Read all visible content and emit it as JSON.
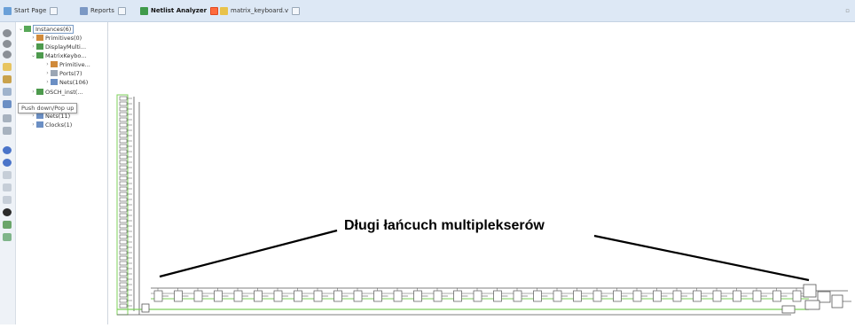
{
  "tabs": [
    {
      "label": "Start Page",
      "icon": "start-page-icon",
      "active": false
    },
    {
      "label": "Reports",
      "icon": "reports-icon",
      "active": false
    },
    {
      "label": "Netlist Analyzer",
      "icon": "netlist-analyzer-icon",
      "active": true
    },
    {
      "label": "matrix_keyboard.v",
      "icon": "verilog-file-icon",
      "active": false
    }
  ],
  "tooltip": "Push down/Pop up",
  "tree": {
    "instances": "Instances(6)",
    "primitives_1": "Primitives(0)",
    "display_multi": "DisplayMulti...",
    "matrix_keybo": "MatrixKeybo...",
    "primitive_2": "Primitive...",
    "ports": "Ports(7)",
    "nets_inner": "Nets(106)",
    "osch_inst": "OSCH_inst(...",
    "nets": "Nets(11)",
    "clocks": "Clocks(1)"
  },
  "annotation": "Długi łańcuch multiplekserów",
  "colors": {
    "tab_bar_bg": "#dde8f5",
    "active_tab_badge": "#ff6a3d",
    "wire_green": "#7ccf5a",
    "component_line": "#555555"
  }
}
